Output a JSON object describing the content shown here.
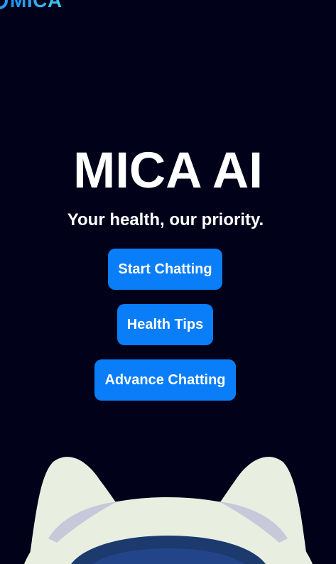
{
  "header": {
    "logo_text": "MICA",
    "logo_icon": "mica-logo-icon"
  },
  "hero": {
    "title": "MICA AI",
    "tagline": "Your health, our priority."
  },
  "actions": {
    "start_chatting": "Start Chatting",
    "health_tips": "Health Tips",
    "advance_chatting": "Advance Chatting"
  },
  "mascot": {
    "icon": "robot-mascot-icon"
  },
  "colors": {
    "background": "#01011a",
    "button": "#0a7df8",
    "text": "#ffffff",
    "logo_gradient_start": "#1b8ff0",
    "logo_gradient_end": "#46c7ee"
  }
}
